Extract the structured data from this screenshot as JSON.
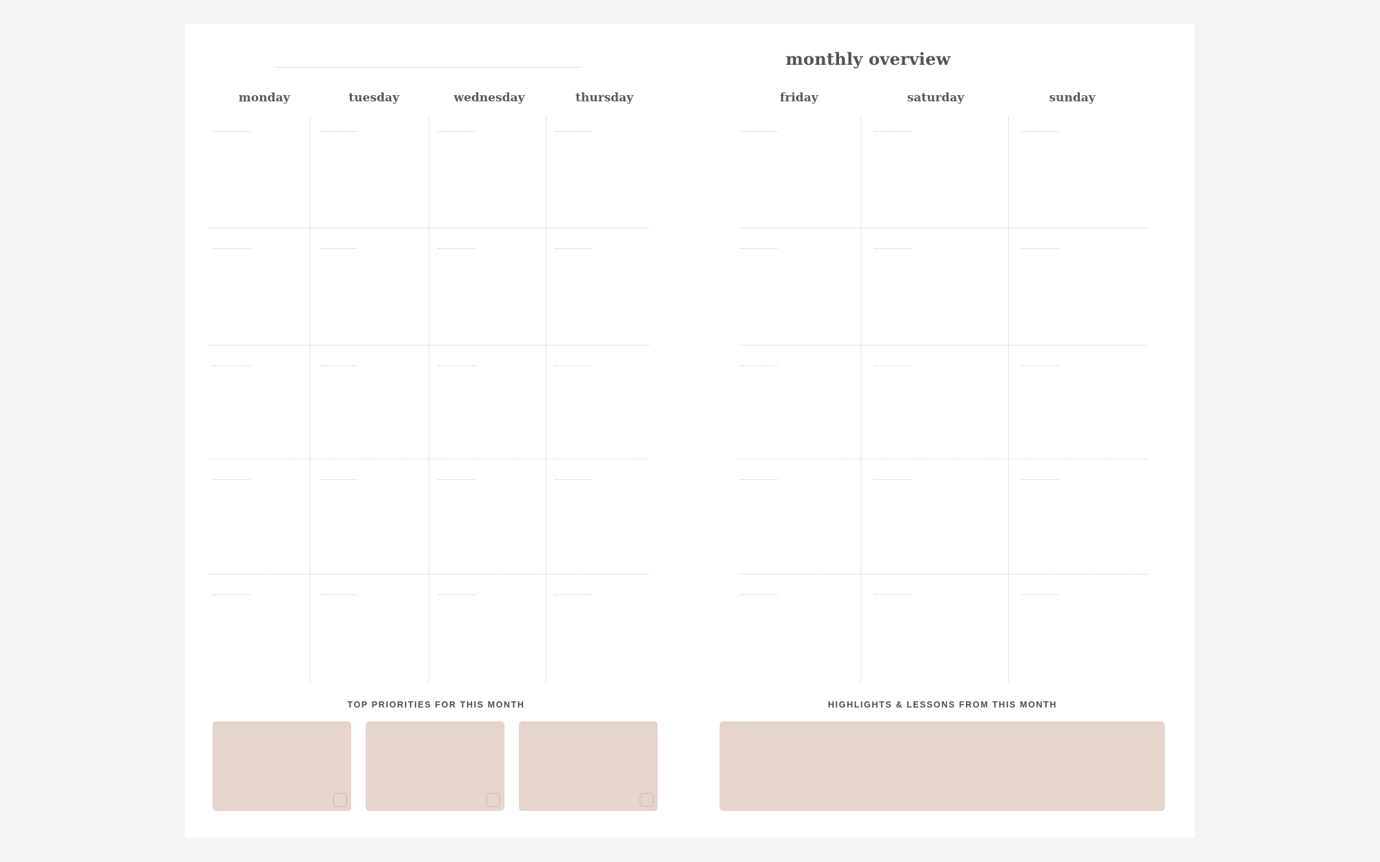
{
  "header": {
    "title": "monthly overview"
  },
  "weekdays": {
    "left": [
      "monday",
      "tuesday",
      "wednesday",
      "thursday"
    ],
    "right": [
      "friday",
      "saturday",
      "sunday"
    ]
  },
  "calendar": {
    "weeks": 5
  },
  "priorities": {
    "label": "TOP PRIORITIES FOR THIS MONTH",
    "box_count": 3
  },
  "highlights": {
    "label": "HIGHLIGHTS & LESSONS FROM THIS MONTH"
  },
  "colors": {
    "page_background": "#f5f4f2",
    "sheet": "#ffffff",
    "box_fill": "#e5d5cc",
    "text": "#55534f",
    "grid_line": "#cfccc8"
  }
}
